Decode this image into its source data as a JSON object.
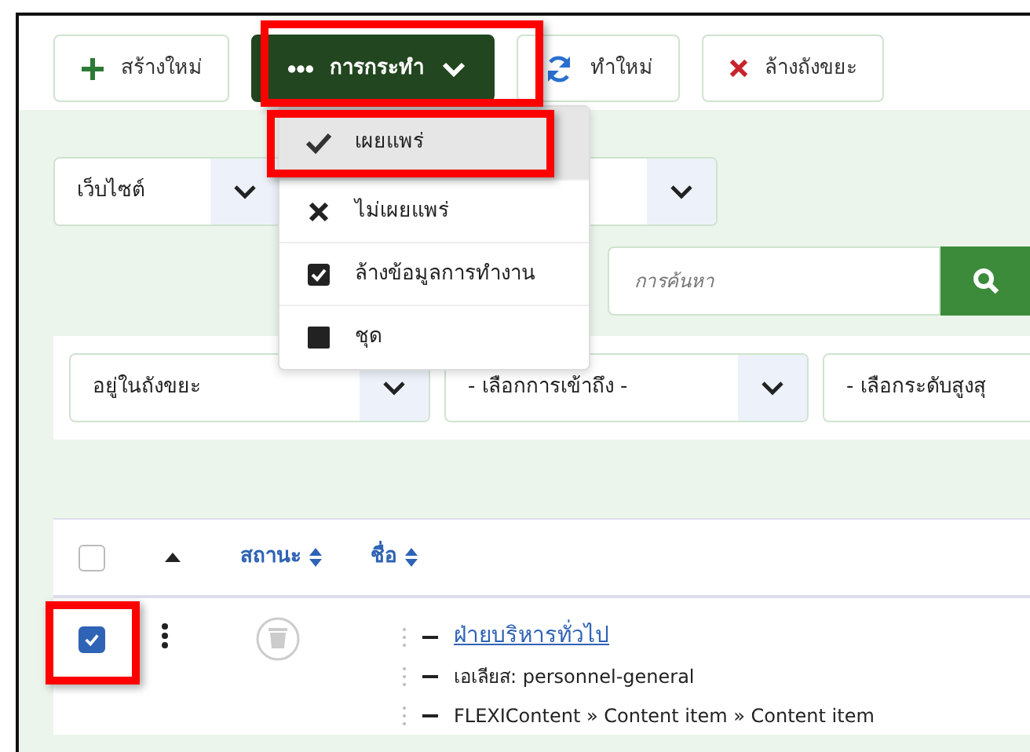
{
  "toolbar": [
    {
      "label": "สร้างใหม่",
      "kind": "new"
    },
    {
      "label": "การกระทำ",
      "kind": "actions",
      "expanded": true
    },
    {
      "label": "ทำใหม่",
      "kind": "refresh"
    },
    {
      "label": "ล้างถังขยะ",
      "kind": "trash"
    }
  ],
  "actions_menu": [
    {
      "label": "เผยแพร่",
      "kind": "check",
      "selected": true
    },
    {
      "label": "ไม่เผยแพร่",
      "kind": "cross",
      "selected": false
    },
    {
      "label": "ล้างข้อมูลการทำงาน",
      "kind": "checkbox",
      "selected": false
    },
    {
      "label": "ชุด",
      "kind": "square",
      "selected": false
    }
  ],
  "site_select": {
    "value": "เว็บไซต์"
  },
  "search": {
    "placeholder": "การค้นหา"
  },
  "filters": [
    {
      "value": "อยู่ในถังขยะ"
    },
    {
      "value": "- เลือกการเข้าถึง -"
    },
    {
      "value": "- เลือกระดับสูงสุ"
    }
  ],
  "table": {
    "select_all": {
      "checked": false
    },
    "columns": [
      "สถานะ",
      "ชื่อ"
    ],
    "rows": [
      {
        "checked": true,
        "title": "ฝ่ายบริหารทั่วไป",
        "alias": "เอเลียส: personnel-general",
        "type": "FLEXIContent » Content item » Content item"
      }
    ]
  }
}
